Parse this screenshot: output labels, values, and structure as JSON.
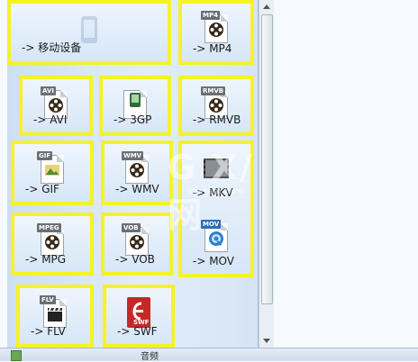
{
  "tiles": [
    {
      "name": "mobile",
      "label": "-> 移动设备",
      "tag": "",
      "icon": "mobile-device-icon"
    },
    {
      "name": "mp4",
      "label": "-> MP4",
      "tag": "MP4",
      "icon": "film-reel-icon"
    },
    {
      "name": "avi",
      "label": "-> AVI",
      "tag": "AVI",
      "icon": "film-reel-icon"
    },
    {
      "name": "3gp",
      "label": "-> 3GP",
      "tag": "3GP",
      "icon": "phone-video-icon"
    },
    {
      "name": "rmvb",
      "label": "-> RMVB",
      "tag": "RMVB",
      "icon": "film-reel-icon"
    },
    {
      "name": "gif",
      "label": "-> GIF",
      "tag": "GIF",
      "icon": "image-icon"
    },
    {
      "name": "wmv",
      "label": "-> WMV",
      "tag": "WMV",
      "icon": "film-reel-icon"
    },
    {
      "name": "mkv",
      "label": "-> MKV",
      "tag": "",
      "icon": "filmstrip-icon"
    },
    {
      "name": "mpg",
      "label": "-> MPG",
      "tag": "MPEG",
      "icon": "film-reel-icon"
    },
    {
      "name": "vob",
      "label": "-> VOB",
      "tag": "VOB",
      "icon": "film-reel-icon"
    },
    {
      "name": "mov",
      "label": "-> MOV",
      "tag": "MOV",
      "icon": "quicktime-icon"
    },
    {
      "name": "flv",
      "label": "-> FLV",
      "tag": "FLV",
      "icon": "clapperboard-icon"
    },
    {
      "name": "swf",
      "label": "-> SWF",
      "tag": "SWF",
      "icon": "flash-icon"
    }
  ],
  "bottom_bar": {
    "label": "音频"
  },
  "watermark": {
    "text": "G X/网",
    "sub": "system.com"
  },
  "colors": {
    "highlight": "#f5f228",
    "panel": "#d6e6f7",
    "tag_gray": "#6b6f75",
    "tag_red": "#c0392b",
    "tag_blue": "#2e6db4"
  }
}
